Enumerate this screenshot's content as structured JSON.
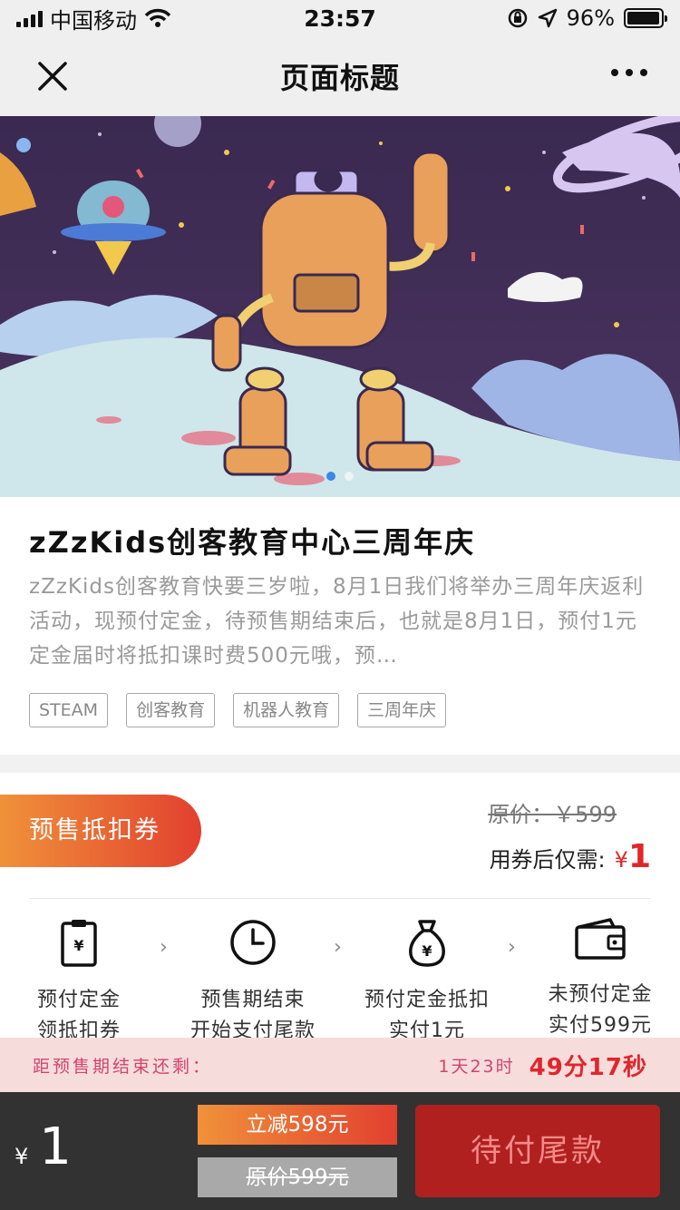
{
  "status_bar": {
    "carrier": "中国移动",
    "time": "23:57",
    "battery_percent": "96%",
    "battery_level": 0.96
  },
  "nav": {
    "title": "页面标题",
    "close_icon": "close-icon",
    "more_icon": "more-icon"
  },
  "banner": {
    "slide_count": 2,
    "active_slide": 1
  },
  "info": {
    "title": "zZzKids创客教育中心三周年庆",
    "description": "zZzKids创客教育快要三岁啦，8月1日我们将举办三周年庆返利活动，现预付定金，待预售期结束后，也就是8月1日，预付1元定金届时将抵扣课时费500元哦，预…",
    "tags": [
      "STEAM",
      "创客教育",
      "机器人教育",
      "三周年庆"
    ]
  },
  "price": {
    "coupon_label": "预售抵扣券",
    "original_price": "原价：￥599",
    "after_coupon_label": "用券后仅需:",
    "after_coupon_currency": "¥",
    "after_coupon_value": "1"
  },
  "steps": [
    {
      "icon": "deposit-card-icon",
      "line1": "预付定金",
      "line2": "领抵扣券"
    },
    {
      "icon": "clock-icon",
      "line1": "预售期结束",
      "line2": "开始支付尾款"
    },
    {
      "icon": "money-bag-icon",
      "line1": "预付定金抵扣",
      "line2": "实付1元"
    },
    {
      "icon": "wallet-icon",
      "line1": "未预付定金",
      "line2": "实付599元"
    }
  ],
  "countdown": {
    "label": "距预售期结束还剩：",
    "days_hours": "1天23时",
    "minutes_seconds": "49分17秒"
  },
  "bottom_bar": {
    "currency": "¥",
    "price": "1",
    "reduce_label": "立减598元",
    "original_label": "原价599元",
    "pay_button": "待付尾款"
  },
  "colors": {
    "accent_red": "#e0262b",
    "pay_button": "#b0201f",
    "coupon_gradient_start": "#f0913a",
    "coupon_gradient_end": "#e2402f",
    "countdown_bg": "#f7dcdc"
  }
}
